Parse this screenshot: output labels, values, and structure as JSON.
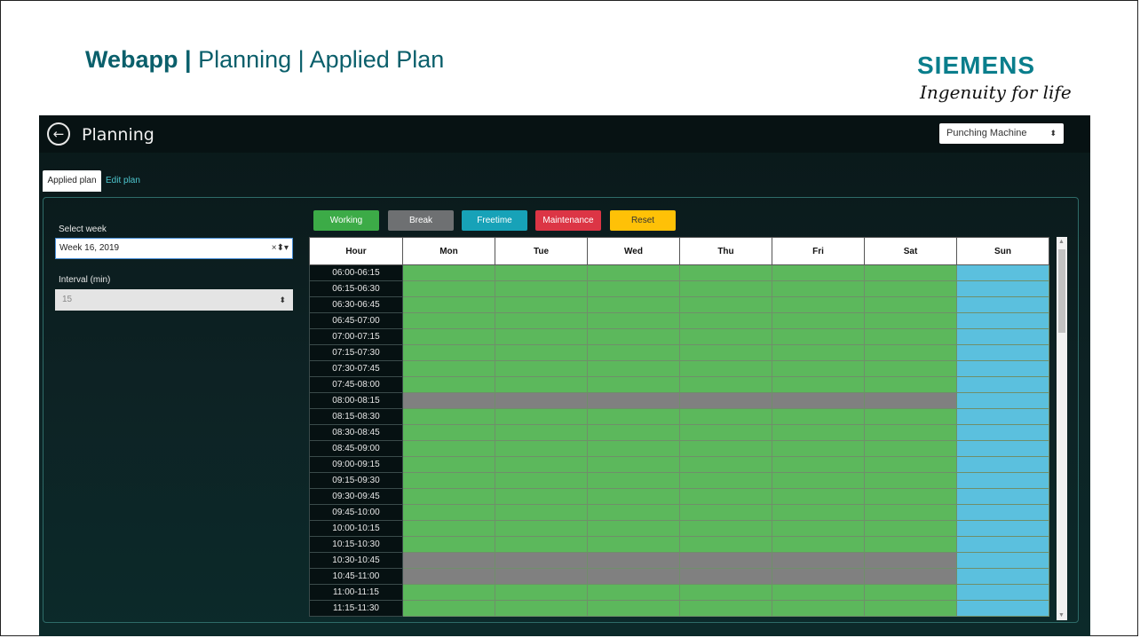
{
  "slide": {
    "title_bold": "Webapp |",
    "title_rest": " Planning | Applied Plan",
    "brand_name": "SIEMENS",
    "brand_slogan": "Ingenuity for life"
  },
  "header": {
    "back_icon": "arrow-left-circle-icon",
    "title": "Planning",
    "machine_selected": "Punching Machine",
    "caret": "⬍"
  },
  "tabs": [
    {
      "label": "Applied plan",
      "active": true
    },
    {
      "label": "Edit plan",
      "active": false
    }
  ],
  "form": {
    "week_label": "Select week",
    "week_value": "Week 16, 2019",
    "week_controls": "×⬍▾",
    "interval_label": "Interval (min)",
    "interval_value": "15"
  },
  "legend": [
    {
      "label": "Working",
      "color": "#3cab47"
    },
    {
      "label": "Break",
      "color": "#6e7072"
    },
    {
      "label": "Freetime",
      "color": "#17a2b8"
    },
    {
      "label": "Maintenance",
      "color": "#dc3545"
    },
    {
      "label": "Reset",
      "color": "#ffc107"
    }
  ],
  "state_colors": {
    "W": "#5cb85c",
    "B": "#808080",
    "F": "#5bc0de"
  },
  "table": {
    "headers": [
      "Hour",
      "Mon",
      "Tue",
      "Wed",
      "Thu",
      "Fri",
      "Sat",
      "Sun"
    ],
    "rows": [
      {
        "hour": "06:00-06:15",
        "cells": [
          "W",
          "W",
          "W",
          "W",
          "W",
          "W",
          "F"
        ]
      },
      {
        "hour": "06:15-06:30",
        "cells": [
          "W",
          "W",
          "W",
          "W",
          "W",
          "W",
          "F"
        ]
      },
      {
        "hour": "06:30-06:45",
        "cells": [
          "W",
          "W",
          "W",
          "W",
          "W",
          "W",
          "F"
        ]
      },
      {
        "hour": "06:45-07:00",
        "cells": [
          "W",
          "W",
          "W",
          "W",
          "W",
          "W",
          "F"
        ]
      },
      {
        "hour": "07:00-07:15",
        "cells": [
          "W",
          "W",
          "W",
          "W",
          "W",
          "W",
          "F"
        ]
      },
      {
        "hour": "07:15-07:30",
        "cells": [
          "W",
          "W",
          "W",
          "W",
          "W",
          "W",
          "F"
        ]
      },
      {
        "hour": "07:30-07:45",
        "cells": [
          "W",
          "W",
          "W",
          "W",
          "W",
          "W",
          "F"
        ]
      },
      {
        "hour": "07:45-08:00",
        "cells": [
          "W",
          "W",
          "W",
          "W",
          "W",
          "W",
          "F"
        ]
      },
      {
        "hour": "08:00-08:15",
        "cells": [
          "B",
          "B",
          "B",
          "B",
          "B",
          "B",
          "F"
        ]
      },
      {
        "hour": "08:15-08:30",
        "cells": [
          "W",
          "W",
          "W",
          "W",
          "W",
          "W",
          "F"
        ]
      },
      {
        "hour": "08:30-08:45",
        "cells": [
          "W",
          "W",
          "W",
          "W",
          "W",
          "W",
          "F"
        ]
      },
      {
        "hour": "08:45-09:00",
        "cells": [
          "W",
          "W",
          "W",
          "W",
          "W",
          "W",
          "F"
        ]
      },
      {
        "hour": "09:00-09:15",
        "cells": [
          "W",
          "W",
          "W",
          "W",
          "W",
          "W",
          "F"
        ]
      },
      {
        "hour": "09:15-09:30",
        "cells": [
          "W",
          "W",
          "W",
          "W",
          "W",
          "W",
          "F"
        ]
      },
      {
        "hour": "09:30-09:45",
        "cells": [
          "W",
          "W",
          "W",
          "W",
          "W",
          "W",
          "F"
        ]
      },
      {
        "hour": "09:45-10:00",
        "cells": [
          "W",
          "W",
          "W",
          "W",
          "W",
          "W",
          "F"
        ]
      },
      {
        "hour": "10:00-10:15",
        "cells": [
          "W",
          "W",
          "W",
          "W",
          "W",
          "W",
          "F"
        ]
      },
      {
        "hour": "10:15-10:30",
        "cells": [
          "W",
          "W",
          "W",
          "W",
          "W",
          "W",
          "F"
        ]
      },
      {
        "hour": "10:30-10:45",
        "cells": [
          "B",
          "B",
          "B",
          "B",
          "B",
          "B",
          "F"
        ]
      },
      {
        "hour": "10:45-11:00",
        "cells": [
          "B",
          "B",
          "B",
          "B",
          "B",
          "B",
          "F"
        ]
      },
      {
        "hour": "11:00-11:15",
        "cells": [
          "W",
          "W",
          "W",
          "W",
          "W",
          "W",
          "F"
        ]
      },
      {
        "hour": "11:15-11:30",
        "cells": [
          "W",
          "W",
          "W",
          "W",
          "W",
          "W",
          "F"
        ]
      }
    ]
  },
  "scrollbar": {
    "up_icon": "triangle-up-icon",
    "down_icon": "triangle-down-icon"
  }
}
